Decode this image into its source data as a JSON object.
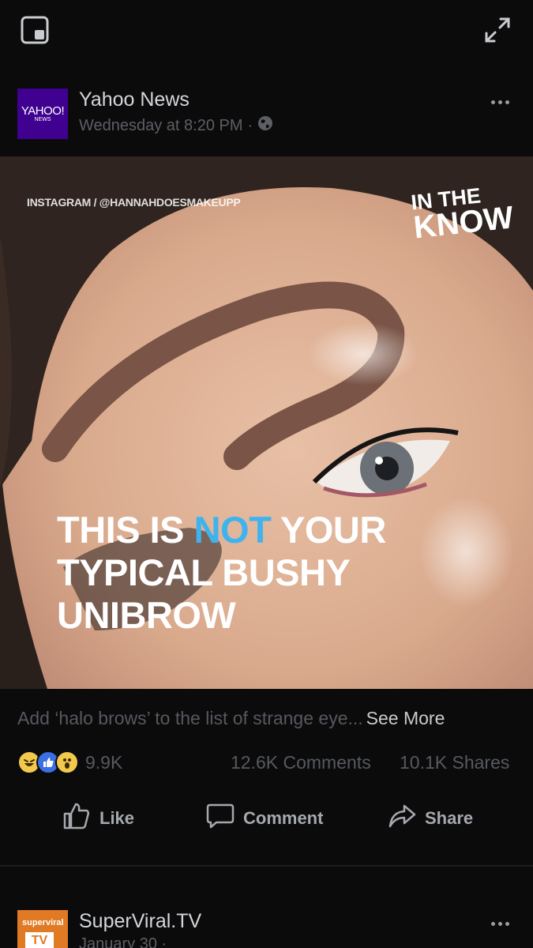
{
  "top_bar": {
    "pip_icon": "picture-in-picture-icon",
    "expand_icon": "expand-icon"
  },
  "post": {
    "page_name": "Yahoo News",
    "avatar_text": "YAHOO!",
    "avatar_subtext": "NEWS",
    "timestamp": "Wednesday at 8:20 PM",
    "separator": "·",
    "privacy_icon": "globe-icon",
    "more_icon": "more-options-icon",
    "video": {
      "credit": "INSTAGRAM / @HANNAHDOESMAKEUPP",
      "badge_line1": "IN THE",
      "badge_line2": "KNOW",
      "caption_part1": "THIS IS ",
      "caption_highlight": "NOT",
      "caption_part2": " YOUR",
      "caption_line2": "TYPICAL BUSHY",
      "caption_line3": "UNIBROW"
    },
    "text": "Add ‘halo brows’ to the list of strange eye...",
    "see_more": "See More",
    "reactions_count": "9.9K",
    "comments_count": "12.6K Comments",
    "shares_count": "10.1K Shares",
    "actions": {
      "like": "Like",
      "comment": "Comment",
      "share": "Share"
    }
  },
  "next_post": {
    "page_name": "SuperViral.TV",
    "avatar_text1": "superviral",
    "avatar_text2": "TV",
    "timestamp": "January 30 ·"
  },
  "colors": {
    "background": "#0b0b0c",
    "caption_highlight": "#3db3ef",
    "yahoo_purple": "#400090"
  }
}
